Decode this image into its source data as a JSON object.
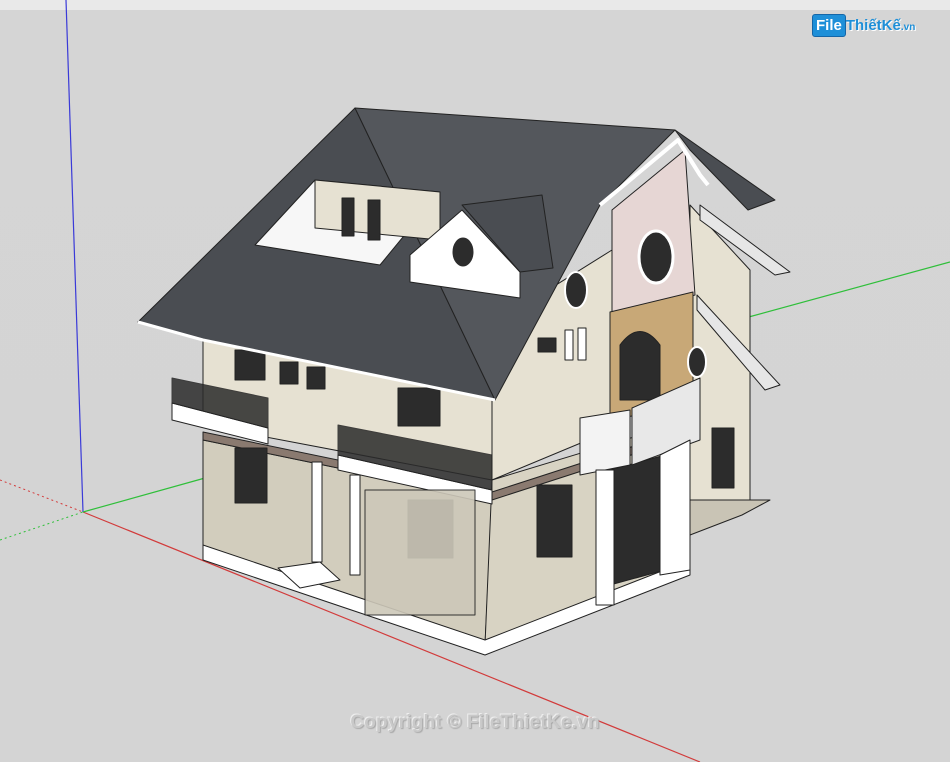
{
  "watermark": {
    "logo_box": "File",
    "logo_rest": "ThiếtKế",
    "logo_suffix": ".vn",
    "copyright": "Copyright © FileThietKe.vn"
  },
  "colors": {
    "background": "#d4d4d4",
    "roof": "#4a4d52",
    "wall": "#e6e1d2",
    "wall_lower": "#d2cdbd",
    "pink_wall": "#e6d6d4",
    "stone": "#c8a877",
    "axis_red": "#d23b3b",
    "axis_green": "#2fbf3a",
    "axis_blue": "#3a3ad8",
    "brand_blue": "#1e8fd8"
  },
  "icons": [
    "house-model",
    "red-axis",
    "green-axis",
    "blue-axis"
  ]
}
